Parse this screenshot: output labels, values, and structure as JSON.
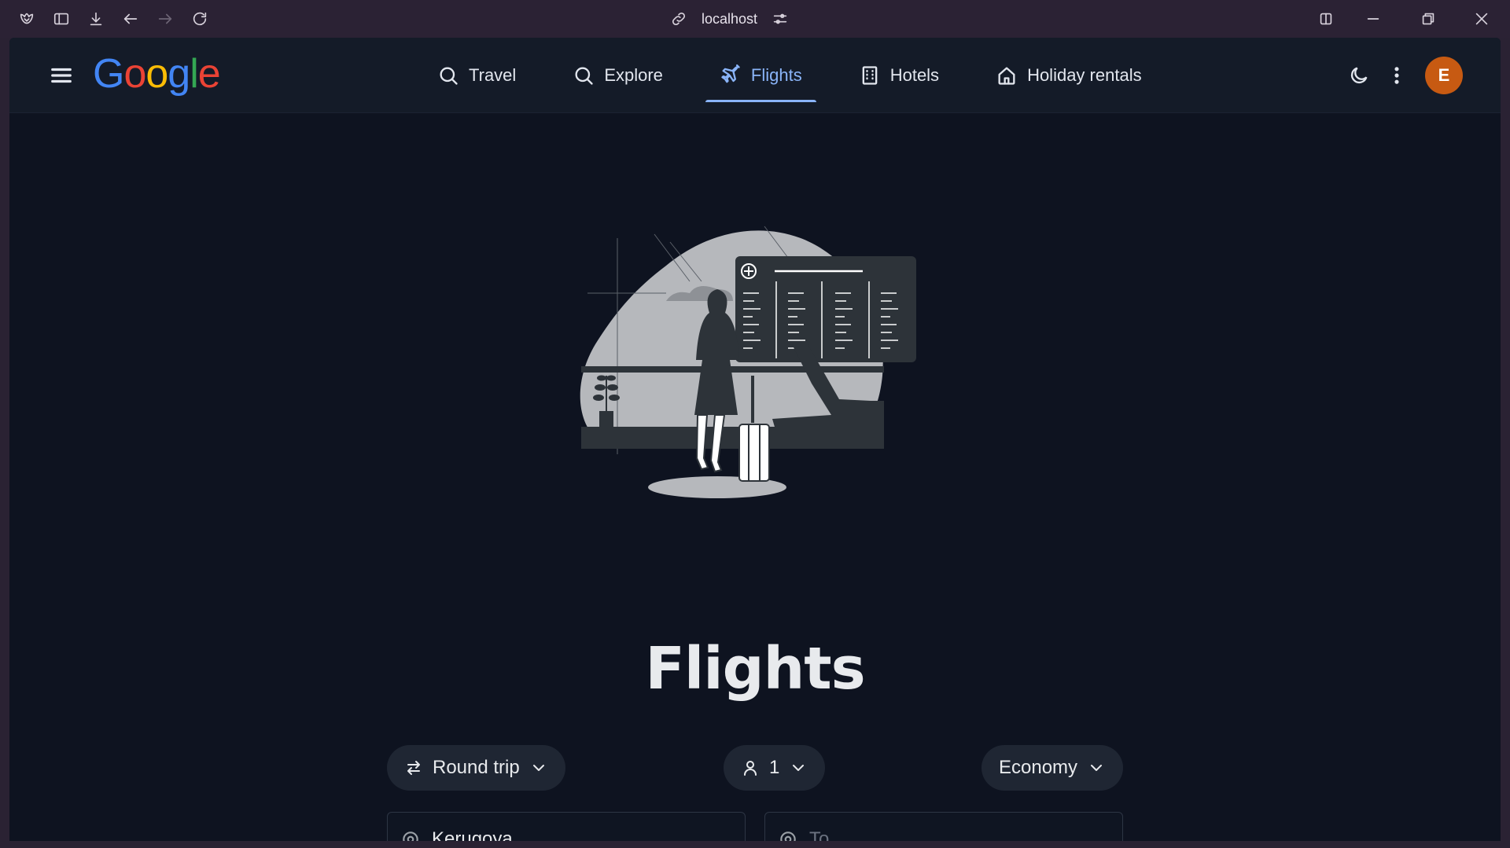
{
  "browser": {
    "address": "localhost"
  },
  "header": {
    "logo_letters": [
      {
        "ch": "G",
        "color": "#4285f4"
      },
      {
        "ch": "o",
        "color": "#ea4335"
      },
      {
        "ch": "o",
        "color": "#fbbc05"
      },
      {
        "ch": "g",
        "color": "#4285f4"
      },
      {
        "ch": "l",
        "color": "#34a853"
      },
      {
        "ch": "e",
        "color": "#ea4335"
      }
    ],
    "nav": [
      {
        "label": "Travel",
        "icon": "search-icon"
      },
      {
        "label": "Explore",
        "icon": "search-icon"
      },
      {
        "label": "Flights",
        "icon": "plane-icon",
        "active": true
      },
      {
        "label": "Hotels",
        "icon": "building-icon"
      },
      {
        "label": "Holiday rentals",
        "icon": "house-icon"
      }
    ],
    "avatar_letter": "E"
  },
  "main": {
    "title": "Flights",
    "trip_type": "Round trip",
    "passengers": "1",
    "cabin_class": "Economy",
    "from_value": "Kerugoya",
    "to_placeholder": "To"
  },
  "colors": {
    "accent": "#8ab4f8",
    "avatar": "#c75a12",
    "background": "#0e1320"
  }
}
